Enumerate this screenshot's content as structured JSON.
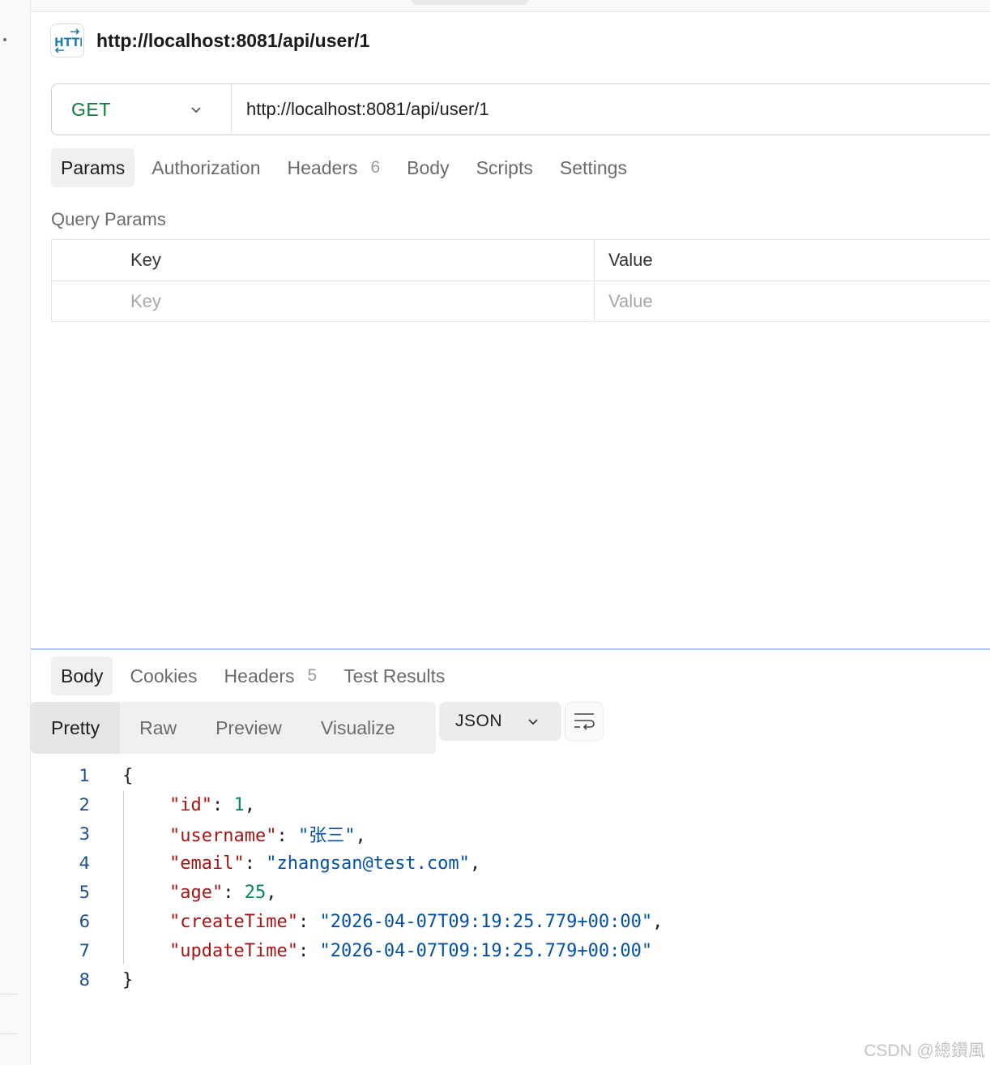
{
  "request": {
    "title": "http://localhost:8081/api/user/1",
    "method": "GET",
    "url": "http://localhost:8081/api/user/1",
    "tabs": [
      {
        "label": "Params",
        "count": ""
      },
      {
        "label": "Authorization",
        "count": ""
      },
      {
        "label": "Headers",
        "count": "6"
      },
      {
        "label": "Body",
        "count": ""
      },
      {
        "label": "Scripts",
        "count": ""
      },
      {
        "label": "Settings",
        "count": ""
      }
    ],
    "active_tab": "Params"
  },
  "query_params": {
    "section_label": "Query Params",
    "header": {
      "key": "Key",
      "value": "Value"
    },
    "placeholder": {
      "key": "Key",
      "value": "Value"
    }
  },
  "response": {
    "tabs": [
      {
        "label": "Body",
        "count": ""
      },
      {
        "label": "Cookies",
        "count": ""
      },
      {
        "label": "Headers",
        "count": "5"
      },
      {
        "label": "Test Results",
        "count": ""
      }
    ],
    "active_tab": "Body",
    "view_modes": [
      "Pretty",
      "Raw",
      "Preview",
      "Visualize"
    ],
    "active_view": "Pretty",
    "format": "JSON",
    "line_numbers": [
      "1",
      "2",
      "3",
      "4",
      "5",
      "6",
      "7",
      "8"
    ],
    "body": {
      "open": "{",
      "close": "}",
      "fields": [
        {
          "key": "id",
          "value": "1",
          "type": "number"
        },
        {
          "key": "username",
          "value": "张三",
          "type": "string"
        },
        {
          "key": "email",
          "value": "zhangsan@test.com",
          "type": "string"
        },
        {
          "key": "age",
          "value": "25",
          "type": "number"
        },
        {
          "key": "createTime",
          "value": "2026-04-07T09:19:25.779+00:00",
          "type": "string"
        },
        {
          "key": "updateTime",
          "value": "2026-04-07T09:19:25.779+00:00",
          "type": "string"
        }
      ]
    }
  },
  "watermark": "CSDN @總鑽風",
  "colors": {
    "method_get": "#0f7a3e",
    "json_key": "#a31515",
    "json_string": "#0451a5",
    "json_number": "#098658",
    "line_number": "#1d4f86",
    "divider": "#a9c4f5"
  },
  "icons": [
    "http-icon",
    "chevron-down-icon",
    "wrap-lines-icon"
  ]
}
